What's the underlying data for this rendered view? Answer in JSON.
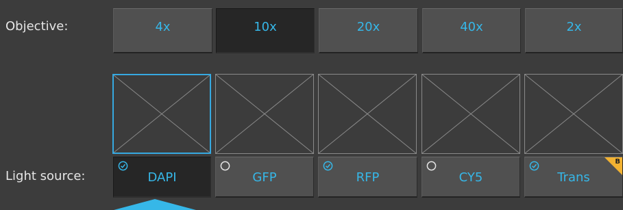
{
  "labels": {
    "objective": "Objective:",
    "light_source": "Light source:"
  },
  "objectives": [
    {
      "label": "4x",
      "selected": false
    },
    {
      "label": "10x",
      "selected": true
    },
    {
      "label": "20x",
      "selected": false
    },
    {
      "label": "40x",
      "selected": false
    },
    {
      "label": "2x",
      "selected": false
    }
  ],
  "thumbnails": [
    {
      "selected": true,
      "icon": "image-placeholder-icon"
    },
    {
      "selected": false,
      "icon": "image-placeholder-icon"
    },
    {
      "selected": false,
      "icon": "image-placeholder-icon"
    },
    {
      "selected": false,
      "icon": "image-placeholder-icon"
    },
    {
      "selected": false,
      "icon": "image-placeholder-icon"
    }
  ],
  "light_sources": [
    {
      "label": "DAPI",
      "checked": true,
      "active": true
    },
    {
      "label": "GFP",
      "checked": false,
      "active": false
    },
    {
      "label": "RFP",
      "checked": true,
      "active": false
    },
    {
      "label": "CY5",
      "checked": false,
      "active": false
    },
    {
      "label": "Trans",
      "checked": true,
      "active": false,
      "badge": "B"
    }
  ],
  "colors": {
    "accent": "#36b7e8",
    "badge": "#f2b232",
    "background": "#3c3c3c"
  }
}
